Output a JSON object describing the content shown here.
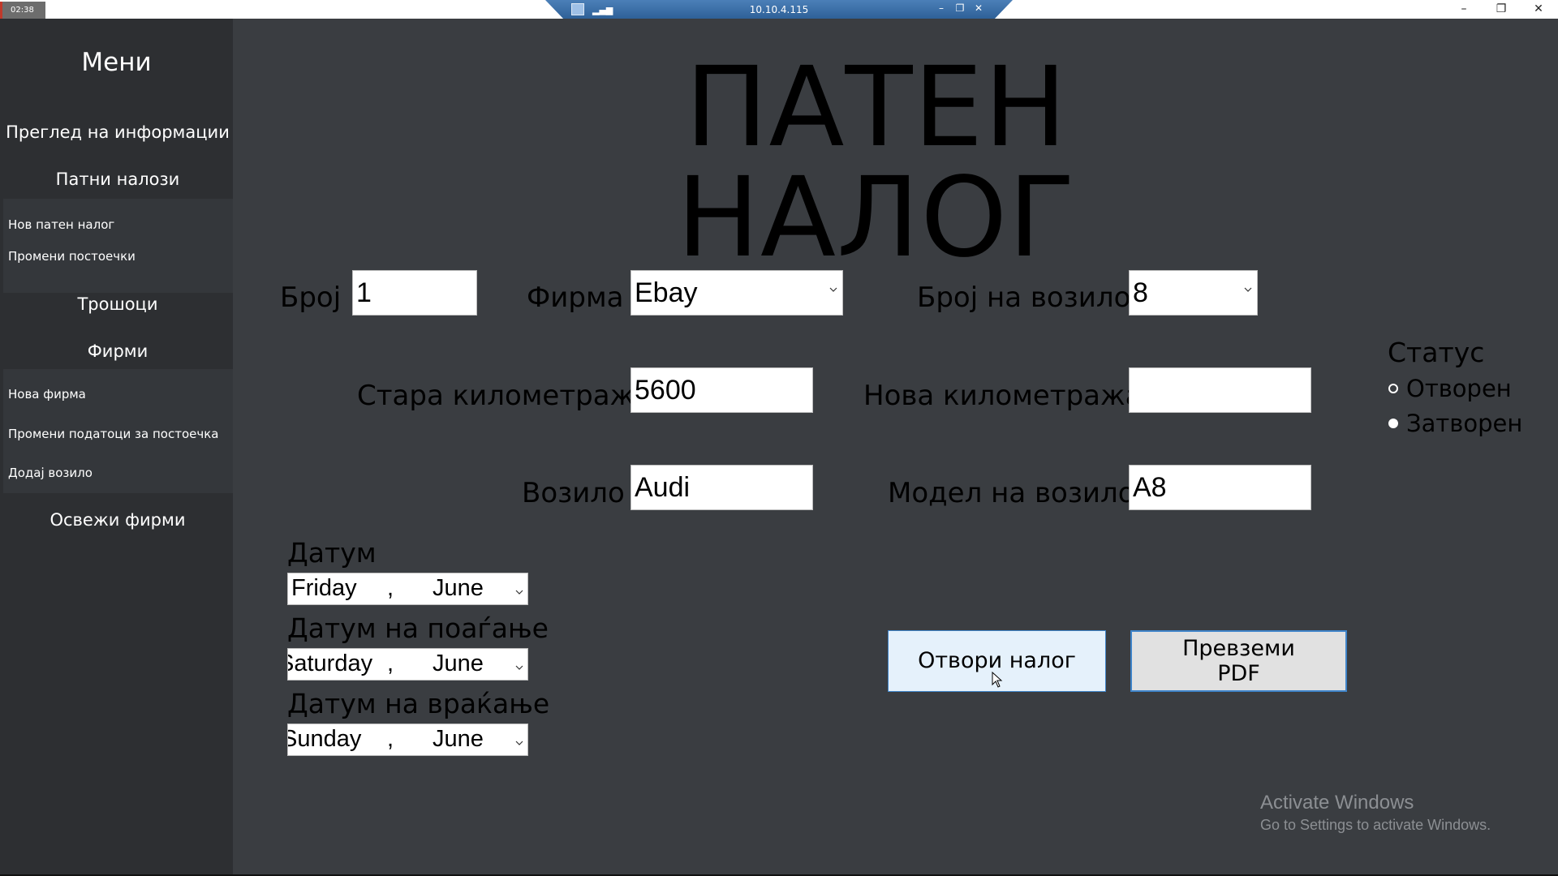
{
  "titlebar": {
    "clock": "02:38",
    "remote_host": "10.10.4.115",
    "window_controls": [
      "minimize-icon",
      "restore-icon",
      "close-icon"
    ]
  },
  "sidebar": {
    "title": "Мени",
    "items": {
      "view_info": "Преглед на информации",
      "trip_orders": "Патни налози",
      "new_trip_order": "Нов патен налог",
      "change_existing": "Промени постоечки",
      "costs": "Трошоци",
      "companies": "Фирми",
      "new_company": "Нова фирма",
      "change_company_data": "Промени податоци за постоечка",
      "add_vehicle": "Додај возило",
      "refresh_companies": "Освежи фирми"
    }
  },
  "main": {
    "heading": "ПАТЕН НАЛОГ",
    "fields": {
      "number_label": "Број",
      "number_value": "1",
      "company_label": "Фирма",
      "company_value": "Ebay",
      "vehicle_number_label": "Број на возило",
      "vehicle_number_value": "8",
      "old_mileage_label": "Стара километража",
      "old_mileage_value": "5600",
      "new_mileage_label": "Нова километража",
      "new_mileage_value": "",
      "vehicle_label": "Возило",
      "vehicle_value": "Audi",
      "vehicle_model_label": "Модел на возило",
      "vehicle_model_value": "A8"
    },
    "dates": {
      "date_label": "Датум",
      "date_day": "Friday",
      "date_month": "June",
      "departure_label": "Датум на поаѓање",
      "departure_day": "Saturday",
      "departure_month": "June",
      "return_label": "Датум на враќање",
      "return_day": "Sunday",
      "return_month": "June",
      "separator": ","
    },
    "status": {
      "title": "Статус",
      "options": [
        "Отворен",
        "Затворен"
      ],
      "selected": "Затворен"
    },
    "buttons": {
      "open_order": "Отвори налог",
      "download_pdf": "Превземи PDF"
    }
  },
  "watermark": {
    "title": "Activate Windows",
    "subtitle": "Go to Settings to activate Windows."
  }
}
